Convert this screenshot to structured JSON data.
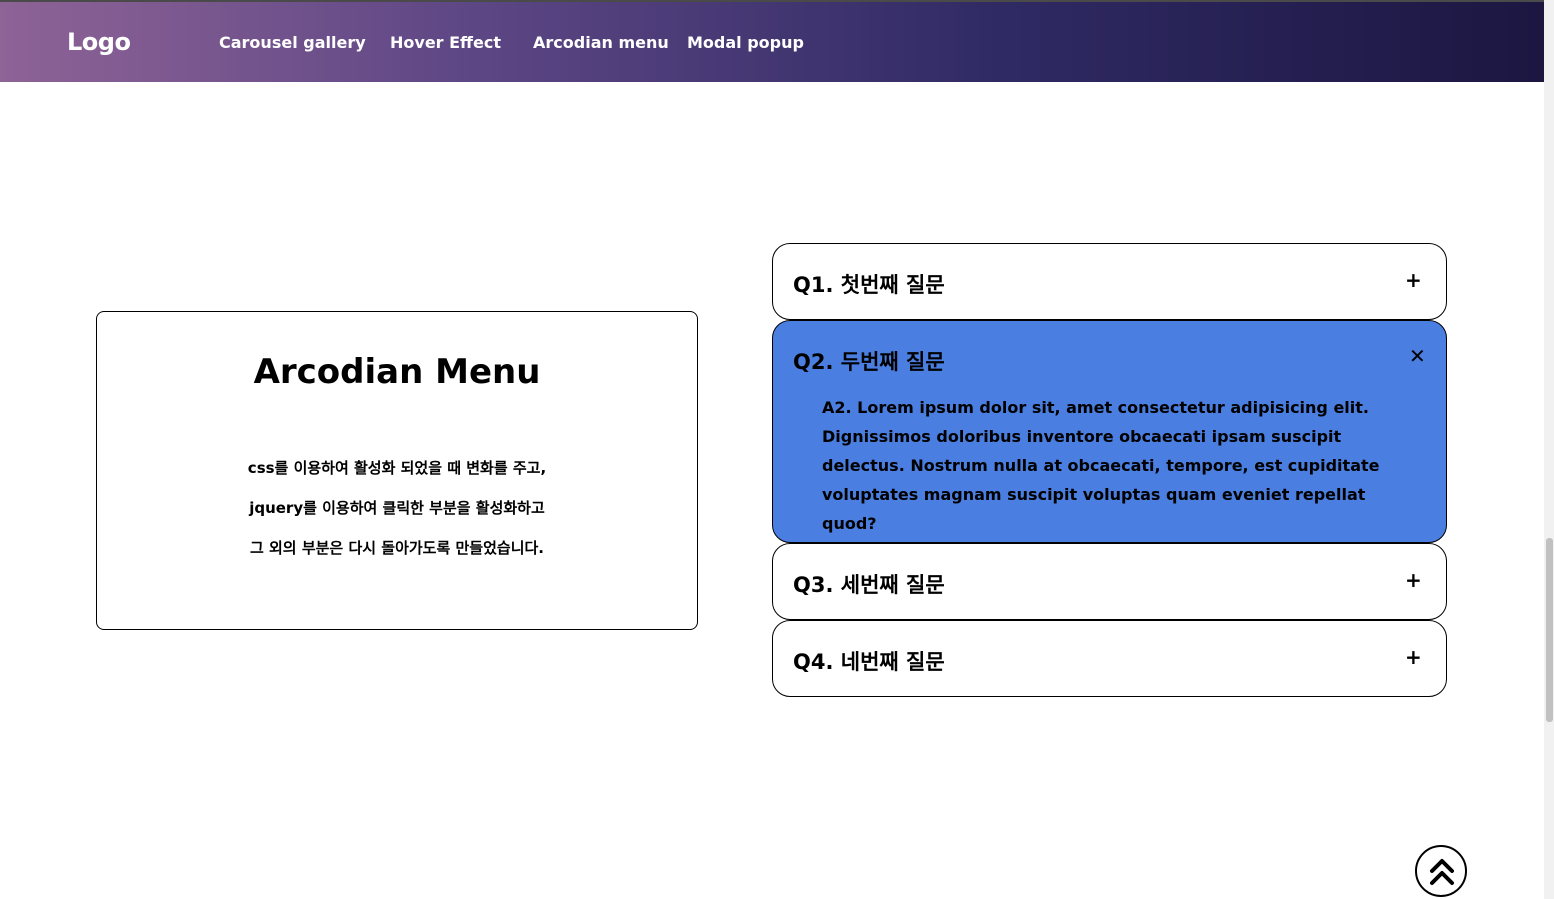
{
  "nav": {
    "logo": "Logo",
    "items": [
      "Carousel gallery",
      "Hover Effect",
      "Arcodian menu",
      "Modal popup"
    ],
    "gradient": [
      "#8e6396",
      "#1c1641"
    ]
  },
  "info": {
    "title": "Arcodian Menu",
    "lines": [
      "css를 이용하여 활성화 되었을 때 변화를 주고,",
      "jquery를 이용하여 클릭한 부분을 활성화하고",
      "그 외의 부분은 다시 돌아가도록 만들었습니다."
    ]
  },
  "accordion": {
    "active_color": "#4a7ee0",
    "items": [
      {
        "question": "Q1. 첫번째 질문",
        "icon": "+",
        "icon_name": "plus-icon"
      },
      {
        "question": "Q2. 두번째 질문",
        "icon": "✕",
        "icon_name": "close-icon",
        "answer": "A2. Lorem ipsum dolor sit, amet consectetur adipisicing elit. Dignissimos doloribus inventore obcaecati ipsam suscipit delectus. Nostrum nulla at obcaecati, tempore, est cupiditate voluptates magnam suscipit voluptas quam eveniet repellat quod?"
      },
      {
        "question": "Q3. 세번째 질문",
        "icon": "+",
        "icon_name": "plus-icon"
      },
      {
        "question": "Q4. 네번째 질문",
        "icon": "+",
        "icon_name": "plus-icon"
      }
    ]
  },
  "scroll_top": {
    "icon": "double-chevron-up-icon"
  }
}
